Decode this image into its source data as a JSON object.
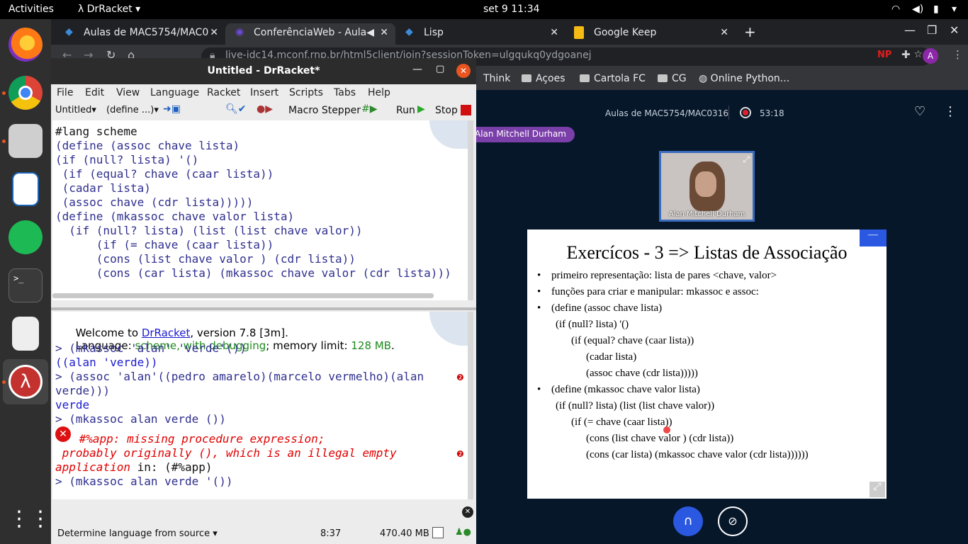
{
  "topbar": {
    "activities": "Activities",
    "app": "DrRacket",
    "datetime": "set 9  11:34"
  },
  "dock": {
    "items": [
      "firefox-icon",
      "chrome-icon",
      "files-icon",
      "writer-icon",
      "spotify-icon",
      "terminal-icon",
      "reader-icon",
      "drracket-icon",
      "apps-grid-icon"
    ]
  },
  "chrome": {
    "tabs": [
      {
        "label": "Aulas de MAC5754/MAC0"
      },
      {
        "label": "ConferênciaWeb - Aula"
      },
      {
        "label": "Lisp"
      },
      {
        "label": "Google Keep"
      }
    ],
    "url": "live-idc14.mconf.rnp.br/html5client/join?sessionToken=ulgqukq0ydgoanej",
    "ext_np": "NP",
    "avatar": "A",
    "bookmarks": [
      "Think",
      "Açoes",
      "Cartola FC",
      "CG",
      "Online Python..."
    ]
  },
  "conference": {
    "title": "Aulas de MAC5754/MAC0316",
    "rec_time": "53:18",
    "presenter": "Alan Mitchell Durham",
    "webcam_name": "Alan Mitchell Durham",
    "slide": {
      "title": "Exercícos - 3  => Listas de Associação",
      "lines": [
        {
          "b": "•",
          "t": "primeiro  representação: lista de pares <chave, valor>"
        },
        {
          "b": "•",
          "t": "funções para criar e manipular: mkassoc e assoc:"
        },
        {
          "b": "•",
          "t": "(define (assoc chave lista)"
        },
        {
          "b": "",
          "t": "(if (null? lista) '()"
        },
        {
          "b": "",
          "t": "(if (equal? chave (caar lista))"
        },
        {
          "b": "",
          "t": "(cadar lista)"
        },
        {
          "b": "",
          "t": "(assoc chave (cdr lista)))))"
        },
        {
          "b": "•",
          "t": "(define (mkassoc chave valor lista)"
        },
        {
          "b": "",
          "t": "(if (null? lista) (list (list chave valor))"
        },
        {
          "b": "",
          "t": "(if (= chave (caar lista))"
        },
        {
          "b": "",
          "t": "(cons (list chave valor ) (cdr lista))"
        },
        {
          "b": "",
          "t": "(cons (car lista) (mkassoc chave valor (cdr lista))))))"
        }
      ]
    }
  },
  "drracket": {
    "title": "Untitled - DrRacket*",
    "menu": [
      "File",
      "Edit",
      "View",
      "Language",
      "Racket",
      "Insert",
      "Scripts",
      "Tabs",
      "Help"
    ],
    "toolbar": {
      "untitled": "Untitled▾",
      "define": "(define ...)▾",
      "macro": "Macro Stepper",
      "run": "Run",
      "stop": "Stop"
    },
    "editor_lines": [
      "#lang scheme",
      "(define (assoc chave lista)",
      "(if (null? lista) '()",
      " (if (equal? chave (caar lista))",
      " (cadar lista)",
      " (assoc chave (cdr lista)))))",
      "(define (mkassoc chave valor lista)",
      "  (if (null? lista) (list (list chave valor))",
      "      (if (= chave (caar lista))",
      "      (cons (list chave valor ) (cdr lista))",
      "      (cons (car lista) (mkassoc chave valor (cdr lista)))"
    ],
    "interactions": {
      "welcome": "Welcome to ",
      "drracket_link": "DrRacket",
      "version": ", version 7.8 [3m].",
      "lang_label": "Language: ",
      "lang_value": "scheme, with debugging",
      "mem_label": "; memory limit: ",
      "mem_value": "128 MB",
      "mem_end": ".",
      "l1": "> (mkassoc 'alan' 'verde'())",
      "l2": "((alan 'verde))",
      "l3": "> (assoc 'alan'((pedro amarelo)(marcelo vermelho)(alan",
      "l4": "verde)))",
      "l5": "verde",
      "l6": "> (mkassoc alan verde ())",
      "e1": " #%app: missing procedure expression;",
      "e2": " probably originally (), which is an illegal empty",
      "e3a": "application",
      "e3b": " in: (#%app)",
      "l7": "> (mkassoc alan verde '())"
    },
    "status": {
      "language": "Determine language from source",
      "position": "8:37",
      "memory": "470.40 MB"
    }
  }
}
